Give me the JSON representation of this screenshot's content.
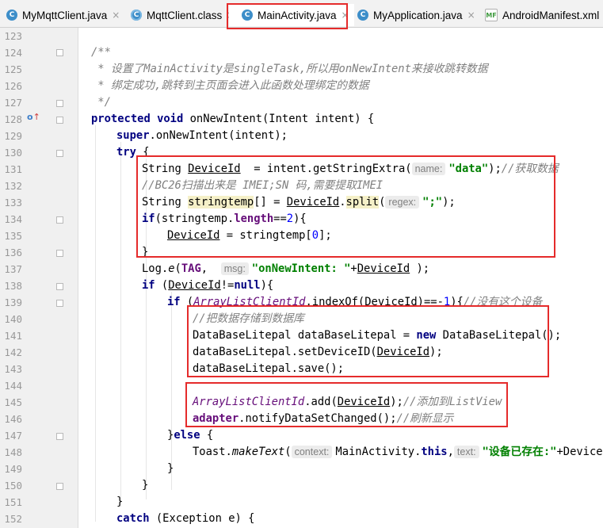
{
  "tabs": [
    {
      "label": "MyMqttClient.java",
      "icon": "java-class-icon",
      "close": "×"
    },
    {
      "label": "MqttClient.class",
      "icon": "compiled-class-icon",
      "close": "×"
    },
    {
      "label": "MainActivity.java",
      "icon": "java-class-icon",
      "close": "×",
      "active": true
    },
    {
      "label": "MyApplication.java",
      "icon": "java-class-icon",
      "close": "×"
    },
    {
      "label": "AndroidManifest.xml",
      "icon": "manifest-xml-icon",
      "close": ""
    }
  ],
  "tab_icon_glyphs": {
    "java": "C",
    "xml": "MF"
  },
  "gutter_marker": {
    "override": "o",
    "arrow": "↑"
  },
  "line_numbers": [
    "123",
    "124",
    "125",
    "126",
    "127",
    "128",
    "129",
    "130",
    "131",
    "132",
    "133",
    "134",
    "135",
    "136",
    "137",
    "138",
    "139",
    "140",
    "141",
    "142",
    "143",
    "144",
    "145",
    "146",
    "147",
    "148",
    "149",
    "150",
    "151",
    "152"
  ],
  "code": {
    "l124": "/**",
    "l125": " * 设置了MainActivity是singleTask,所以用onNewIntent来接收跳转数据",
    "l126": " * 绑定成功,跳转到主页面会进入此函数处理绑定的数据",
    "l127": " */",
    "l128_kw": "protected void",
    "l128_rest": " onNewIntent(Intent intent) {",
    "l129_kw": "super",
    "l129_rest": ".onNewIntent(intent);",
    "l130_kw": "try",
    "l130_rest": " {",
    "l131_a": "String ",
    "l131_var": "DeviceId",
    "l131_b": "  = intent.getStringExtra(",
    "l131_hint": "name:",
    "l131_str": "\"data\"",
    "l131_c": ");",
    "l131_cm": "//获取数据",
    "l132_cm": "//BC26扫描出来是 IMEI;SN 码,需要提取IMEI",
    "l133_a": "String ",
    "l133_var": "stringtemp",
    "l133_b": "[] = ",
    "l133_var2": "DeviceId",
    "l133_c": ".",
    "l133_m": "split",
    "l133_d": "(",
    "l133_hint": "regex:",
    "l133_str": "\";\"",
    "l133_e": ");",
    "l134_kw": "if",
    "l134_a": "(stringtemp.",
    "l134_fld": "length",
    "l134_b": "==",
    "l134_num": "2",
    "l134_c": "){",
    "l135_var": "DeviceId",
    "l135_a": " = stringtemp[",
    "l135_num": "0",
    "l135_b": "];",
    "l136": "}",
    "l137_a": "Log.",
    "l137_m": "e",
    "l137_b": "(",
    "l137_fld": "TAG",
    "l137_c": ",  ",
    "l137_hint": "msg:",
    "l137_str": "\"onNewIntent: \"",
    "l137_d": "+",
    "l137_var": "DeviceId",
    "l137_e": " );",
    "l138_kw": "if",
    "l138_a": " (",
    "l138_var": "DeviceId",
    "l138_b": "!=",
    "l138_kw2": "null",
    "l138_c": "){",
    "l139_kw": "if",
    "l139_a": " (",
    "l139_stat": "ArrayListClientId",
    "l139_b": ".indexOf(DeviceId)==-",
    "l139_num": "1",
    "l139_c": "){",
    "l139_cm": "//没有这个设备",
    "l140_cm": "//把数据存储到数据库",
    "l141_a": "DataBaseLitepal dataBaseLitepal = ",
    "l141_kw": "new",
    "l141_b": " DataBaseLitepal();",
    "l142_a": "dataBaseLitepal.setDeviceID(",
    "l142_var": "DeviceId",
    "l142_b": ");",
    "l143": "dataBaseLitepal.save();",
    "l145_stat": "ArrayListClientId",
    "l145_a": ".add(",
    "l145_var": "DeviceId",
    "l145_b": ");",
    "l145_cm": "//添加到ListView",
    "l146_fld": "adapter",
    "l146_a": ".notifyDataSetChanged();",
    "l146_cm": "//刷新显示",
    "l147_a": "}",
    "l147_kw": "else",
    "l147_b": " {",
    "l148_a": "Toast.",
    "l148_m": "makeText",
    "l148_b": "(",
    "l148_hint": "context:",
    "l148_c": "MainActivity.",
    "l148_kw": "this",
    "l148_d": ",",
    "l148_hint2": "text:",
    "l148_str": "\"设备已存在:\"",
    "l148_e": "+Device",
    "l149": "}",
    "l150": "}",
    "l151": "}",
    "l152_kw": "catch",
    "l152_rest": " (Exception e) {"
  },
  "colors": {
    "keyword": "#000080",
    "comment": "#808080",
    "string": "#008000",
    "number": "#0000ff",
    "field": "#660e7a",
    "highlight_box": "#e52b2b"
  }
}
